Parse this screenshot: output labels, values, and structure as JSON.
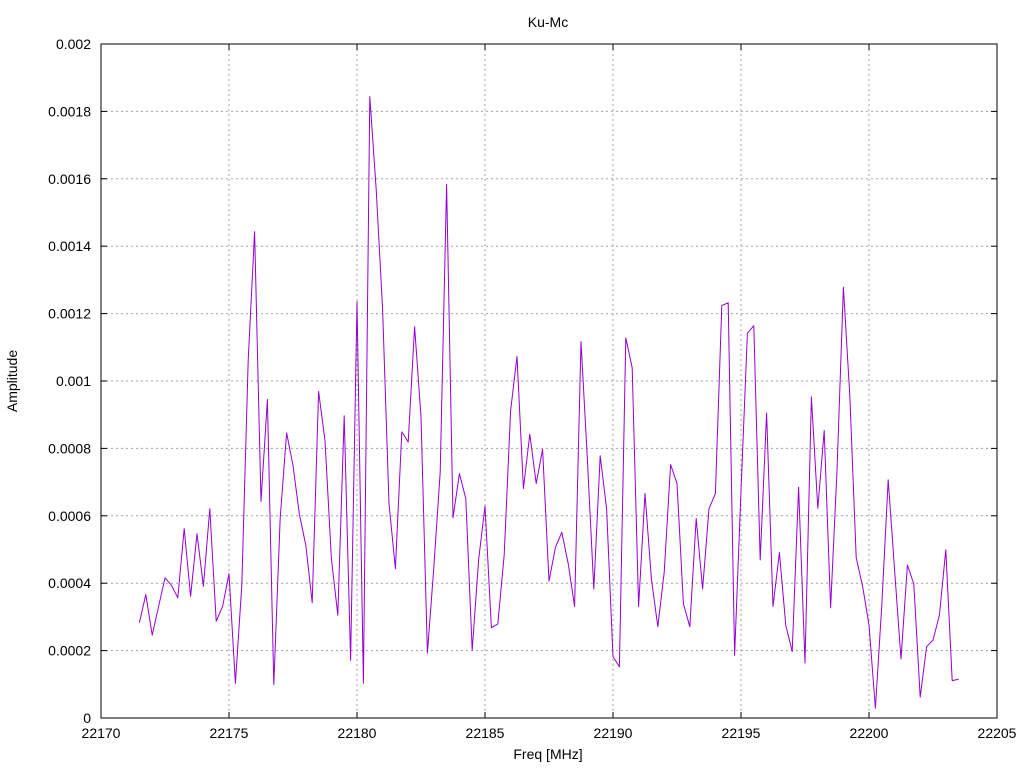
{
  "chart_data": {
    "type": "line",
    "title": "Ku-Mc",
    "xlabel": "Freq [MHz]",
    "ylabel": "Amplitude",
    "xlim": [
      22170,
      22205
    ],
    "ylim": [
      0,
      0.002
    ],
    "grid": true,
    "x_ticks": [
      "22170",
      "22175",
      "22180",
      "22185",
      "22190",
      "22195",
      "22200",
      "22205"
    ],
    "y_ticks": [
      "0",
      "0.0002",
      "0.0004",
      "0.0006",
      "0.0008",
      "0.001",
      "0.0012",
      "0.0014",
      "0.0016",
      "0.0018",
      "0.002"
    ],
    "series": [
      {
        "color": "#9400d3",
        "points": [
          [
            22171.5,
            0.000283
          ],
          [
            22171.75,
            0.000366
          ],
          [
            22172.0,
            0.000246
          ],
          [
            22172.25,
            0.000331
          ],
          [
            22172.5,
            0.000416
          ],
          [
            22172.75,
            0.000394
          ],
          [
            22173.0,
            0.000357
          ],
          [
            22173.25,
            0.000562
          ],
          [
            22173.5,
            0.000361
          ],
          [
            22173.75,
            0.000547
          ],
          [
            22174.0,
            0.000391
          ],
          [
            22174.25,
            0.000621
          ],
          [
            22174.5,
            0.000287
          ],
          [
            22174.75,
            0.000331
          ],
          [
            22175.0,
            0.000428
          ],
          [
            22175.25,
            0.000103
          ],
          [
            22175.5,
            0.000394
          ],
          [
            22175.75,
            0.001062
          ],
          [
            22176.0,
            0.001443
          ],
          [
            22176.25,
            0.000643
          ],
          [
            22176.5,
            0.000945
          ],
          [
            22176.75,
            9.9e-05
          ],
          [
            22177.0,
            0.000594
          ],
          [
            22177.25,
            0.000846
          ],
          [
            22177.5,
            0.000749
          ],
          [
            22177.75,
            0.000604
          ],
          [
            22178.0,
            0.000513
          ],
          [
            22178.25,
            0.000342
          ],
          [
            22178.5,
            0.000969
          ],
          [
            22178.75,
            0.000823
          ],
          [
            22179.0,
            0.000473
          ],
          [
            22179.25,
            0.000305
          ],
          [
            22179.5,
            0.000897
          ],
          [
            22179.75,
            0.000171
          ],
          [
            22180.0,
            0.001235
          ],
          [
            22180.25,
            0.000103
          ],
          [
            22180.5,
            0.001844
          ],
          [
            22180.75,
            0.001568
          ],
          [
            22181.0,
            0.001213
          ],
          [
            22181.25,
            0.000636
          ],
          [
            22181.5,
            0.000443
          ],
          [
            22181.75,
            0.000849
          ],
          [
            22182.0,
            0.000819
          ],
          [
            22182.25,
            0.001161
          ],
          [
            22182.5,
            0.000894
          ],
          [
            22182.75,
            0.000193
          ],
          [
            22183.0,
            0.000446
          ],
          [
            22183.25,
            0.000729
          ],
          [
            22183.5,
            0.001584
          ],
          [
            22183.75,
            0.000594
          ],
          [
            22184.0,
            0.000725
          ],
          [
            22184.25,
            0.000651
          ],
          [
            22184.5,
            0.000201
          ],
          [
            22184.75,
            0.000469
          ],
          [
            22185.0,
            0.000629
          ],
          [
            22185.25,
            0.000268
          ],
          [
            22185.5,
            0.000279
          ],
          [
            22185.75,
            0.000484
          ],
          [
            22186.0,
            0.000912
          ],
          [
            22186.25,
            0.001073
          ],
          [
            22186.5,
            0.000681
          ],
          [
            22186.75,
            0.000842
          ],
          [
            22187.0,
            0.000696
          ],
          [
            22187.25,
            0.000797
          ],
          [
            22187.5,
            0.000406
          ],
          [
            22187.75,
            0.000506
          ],
          [
            22188.0,
            0.000551
          ],
          [
            22188.25,
            0.000458
          ],
          [
            22188.5,
            0.000331
          ],
          [
            22188.75,
            0.001117
          ],
          [
            22189.0,
            0.000766
          ],
          [
            22189.25,
            0.000383
          ],
          [
            22189.5,
            0.000778
          ],
          [
            22189.75,
            0.000621
          ],
          [
            22190.0,
            0.000182
          ],
          [
            22190.25,
            0.000152
          ],
          [
            22190.5,
            0.001128
          ],
          [
            22190.75,
            0.001039
          ],
          [
            22191.0,
            0.000331
          ],
          [
            22191.25,
            0.000666
          ],
          [
            22191.5,
            0.000413
          ],
          [
            22191.75,
            0.000271
          ],
          [
            22192.0,
            0.000432
          ],
          [
            22192.25,
            0.000752
          ],
          [
            22192.5,
            0.000696
          ],
          [
            22192.75,
            0.000339
          ],
          [
            22193.0,
            0.000271
          ],
          [
            22193.25,
            0.000592
          ],
          [
            22193.5,
            0.000383
          ],
          [
            22193.75,
            0.000621
          ],
          [
            22194.0,
            0.000666
          ],
          [
            22194.25,
            0.001224
          ],
          [
            22194.5,
            0.001232
          ],
          [
            22194.75,
            0.000186
          ],
          [
            22195.0,
            0.000674
          ],
          [
            22195.25,
            0.001142
          ],
          [
            22195.5,
            0.001164
          ],
          [
            22195.75,
            0.000469
          ],
          [
            22196.0,
            0.000905
          ],
          [
            22196.25,
            0.000331
          ],
          [
            22196.5,
            0.000491
          ],
          [
            22196.75,
            0.000275
          ],
          [
            22197.0,
            0.000197
          ],
          [
            22197.25,
            0.000685
          ],
          [
            22197.5,
            0.000163
          ],
          [
            22197.75,
            0.000953
          ],
          [
            22198.0,
            0.000622
          ],
          [
            22198.25,
            0.000853
          ],
          [
            22198.5,
            0.000327
          ],
          [
            22198.75,
            0.000734
          ],
          [
            22199.0,
            0.001278
          ],
          [
            22199.25,
            0.000957
          ],
          [
            22199.5,
            0.000476
          ],
          [
            22199.75,
            0.000391
          ],
          [
            22200.0,
            0.000276
          ],
          [
            22200.25,
            2.9e-05
          ],
          [
            22200.5,
            0.000335
          ],
          [
            22200.75,
            0.000707
          ],
          [
            22201.0,
            0.000439
          ],
          [
            22201.25,
            0.000175
          ],
          [
            22201.5,
            0.000454
          ],
          [
            22201.75,
            0.000398
          ],
          [
            22202.0,
            6.2e-05
          ],
          [
            22202.25,
            0.000212
          ],
          [
            22202.5,
            0.000231
          ],
          [
            22202.75,
            0.000305
          ],
          [
            22203.0,
            0.000499
          ],
          [
            22203.25,
            0.000111
          ],
          [
            22203.5,
            0.000115
          ]
        ]
      }
    ]
  }
}
